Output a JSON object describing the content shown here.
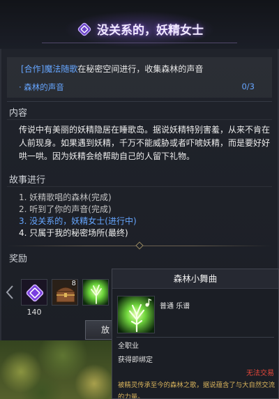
{
  "header": {
    "title": "没关系的，妖精女士",
    "icon": "quest-diamond-icon"
  },
  "objective": {
    "tag": "[合作]魔法随歌",
    "text": "在秘密空间进行，收集森林的声音",
    "item_label": "· 森林的声音",
    "progress": "0/3"
  },
  "content": {
    "heading": "内容",
    "paragraph": "传说中有美丽的妖精隐居在睡歌岛。据说妖精特别害羞，从来不肯在人前现身。如果遇到妖精，千万不能威胁或者吓唬妖精，而是要好好哄一哄。因为妖精会给帮助自己的人留下礼物。"
  },
  "story": {
    "heading": "故事进行",
    "steps": [
      {
        "text": "1. 妖精歌唱的森林(完成)",
        "color": "#c4c4c4"
      },
      {
        "text": "2. 听到了你的声音(完成)",
        "color": "#c4c4c4"
      },
      {
        "text": "3. 没关系的，妖精女士(进行中)",
        "color": "#66a6ff"
      },
      {
        "text": "4. 只属于我的秘密场所(最终)",
        "color": "#f0f0f0"
      }
    ]
  },
  "rewards": {
    "heading": "奖励",
    "prev_icon": "prev-arrow-icon",
    "items": [
      {
        "icon": "purple-gem-icon",
        "amount": "140"
      },
      {
        "icon": "treasure-chest-icon",
        "count": "8"
      },
      {
        "icon": "forest-music-score-icon"
      }
    ],
    "button_label": "放"
  },
  "tooltip": {
    "title": "森林小舞曲",
    "icon": "forest-music-score-icon",
    "grade": "普通",
    "type": "乐谱",
    "class": "全职业",
    "binding": "获得即绑定",
    "trade": "无法交易",
    "description": "被精灵传承至今的森林之歌，据说蕴含了与大自然交流的力量。"
  },
  "colors": {
    "accent_blue": "#66a6ff",
    "title": "#f0e8ff",
    "description_gold": "#d8b35c",
    "untradeable_red": "#e4473a"
  }
}
